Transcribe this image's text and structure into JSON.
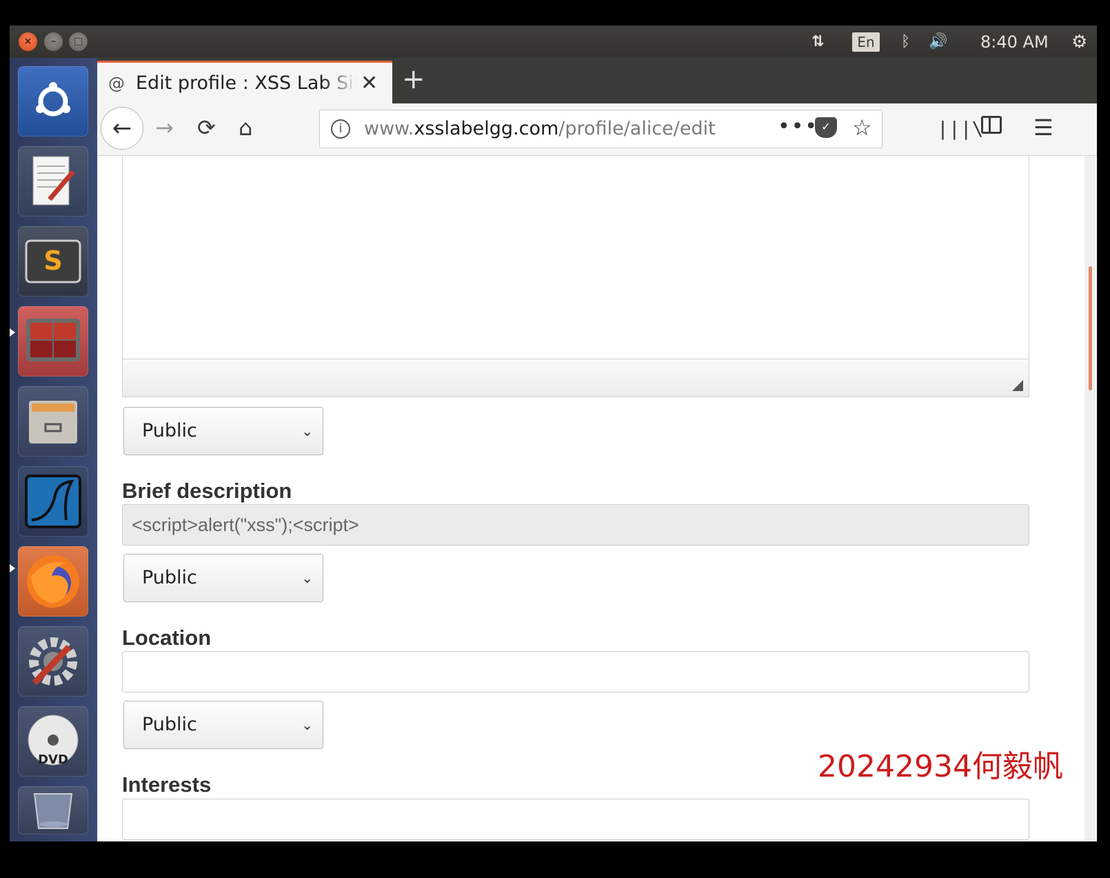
{
  "top_panel": {
    "window_buttons": {
      "close": "×",
      "minimize": "–",
      "maximize": "□"
    },
    "tray": {
      "network": "⇅",
      "language": "En",
      "bluetooth": "ᛒ",
      "volume": "🔊",
      "clock": "8:40 AM",
      "settings": "⚙"
    }
  },
  "launcher": {
    "items": [
      "ubuntu-dash",
      "text-editor",
      "sublime-text",
      "terminal",
      "files",
      "wireshark",
      "firefox",
      "system-settings",
      "dvd",
      "trash"
    ]
  },
  "browser": {
    "tab": {
      "favicon": "@",
      "title": "Edit profile : XSS Lab Site",
      "close": "✕"
    },
    "new_tab": "+",
    "nav": {
      "back": "←",
      "forward": "→",
      "reload": "⟳",
      "home": "⌂"
    },
    "url": {
      "prefix": "www.",
      "domain": "xsslabelgg.com",
      "path": "/profile/alice/edit"
    },
    "url_more": "•••",
    "url_star": "☆",
    "library": "|||\\",
    "menu": "☰"
  },
  "form": {
    "about_access": "Public",
    "brief_label": "Brief description",
    "brief_value": "<script>alert(\"xss\");<script>",
    "brief_access": "Public",
    "location_label": "Location",
    "location_value": "",
    "location_access": "Public",
    "interests_label": "Interests"
  },
  "watermark": "20242934何毅帆",
  "colors": {
    "accent_tab": "#e8613c",
    "watermark": "#cc1c1c",
    "launcher": "#34426a"
  }
}
